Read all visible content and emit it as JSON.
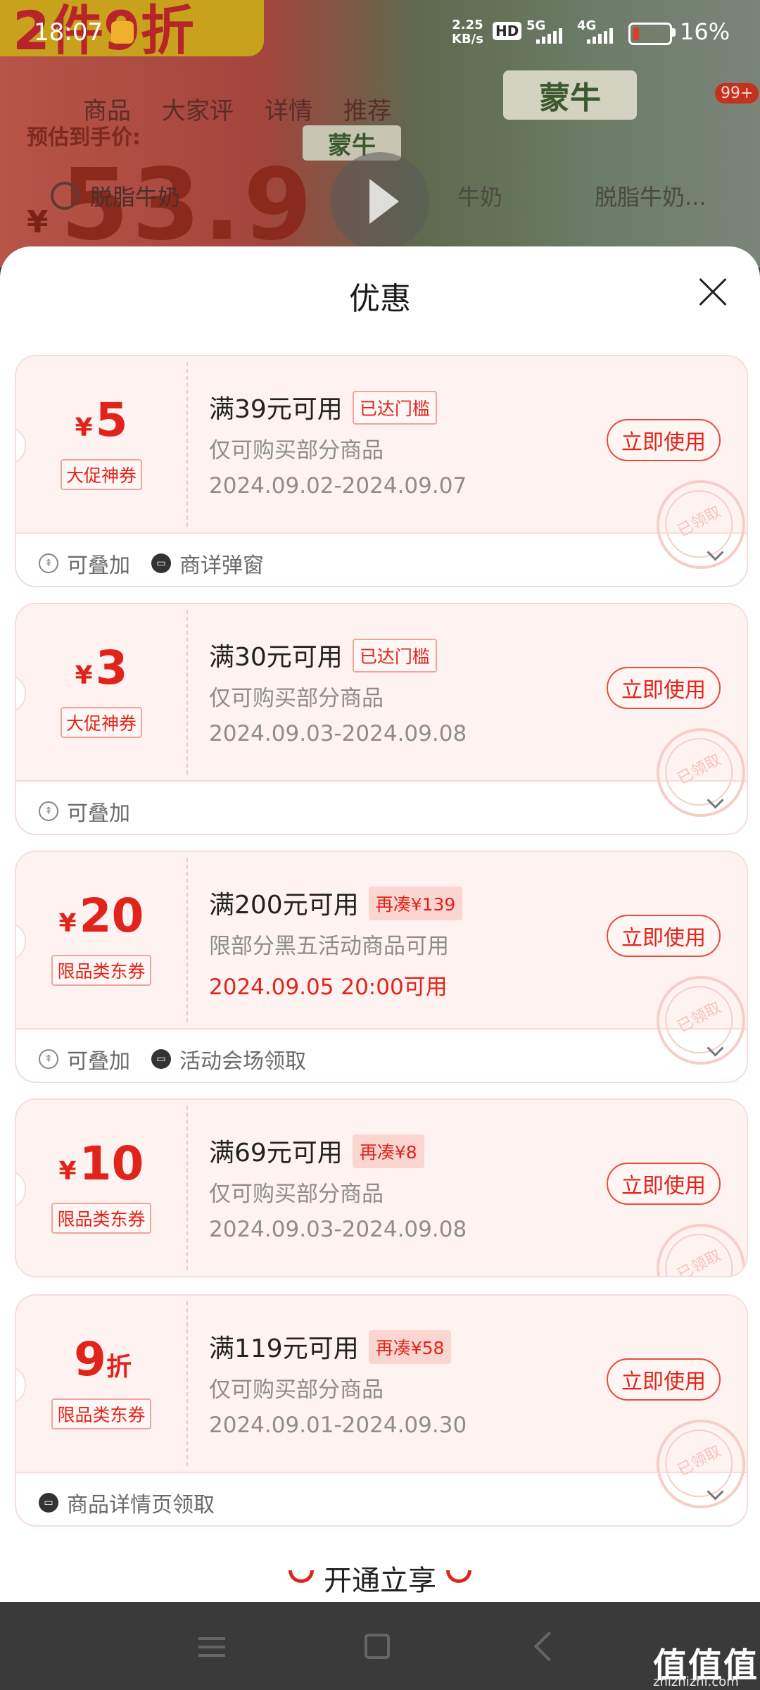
{
  "background": {
    "promo": "2件9折",
    "estimate_label": "预估到手价:",
    "price_symbol": "¥",
    "price": "53.9",
    "tabs": [
      "商品",
      "大家评",
      "详情",
      "推荐"
    ],
    "search_text": "脱脂牛奶",
    "search_text2": "牛奶",
    "search_text3": "脱脂牛奶...",
    "brand": "蒙牛",
    "brand_small": "蒙牛",
    "badge": "99+"
  },
  "status_bar": {
    "time": "18:07",
    "net_speed_top": "2.25",
    "net_speed_bottom": "KB/s",
    "hd": "HD",
    "sig1": "5G",
    "sig2": "4G",
    "battery": "16%"
  },
  "sheet": {
    "title": "优惠",
    "coupons": [
      {
        "currency": "¥",
        "amount": "5",
        "unit": "",
        "type": "大促神券",
        "condition": "满39元可用",
        "tag": "已达门槛",
        "scope": "仅可购买部分商品",
        "date": "2024.09.02-2024.09.07",
        "button": "立即使用",
        "stamp": "已领取"
      },
      {
        "currency": "¥",
        "amount": "3",
        "unit": "",
        "type": "大促神券",
        "condition": "满30元可用",
        "tag": "已达门槛",
        "scope": "仅可购买部分商品",
        "date": "2024.09.03-2024.09.08",
        "button": "立即使用",
        "stamp": "已领取"
      },
      {
        "currency": "¥",
        "amount": "20",
        "unit": "",
        "type": "限品类东券",
        "condition": "满200元可用",
        "tag": "再凑¥139",
        "scope": "限部分黑五活动商品可用",
        "date": "2024.09.05 20:00可用",
        "button": "立即使用",
        "stamp": "已领取"
      },
      {
        "currency": "¥",
        "amount": "10",
        "unit": "",
        "type": "限品类东券",
        "condition": "满69元可用",
        "tag": "再凑¥8",
        "scope": "仅可购买部分商品",
        "date": "2024.09.03-2024.09.08",
        "button": "立即使用",
        "stamp": "已领取"
      },
      {
        "currency": "",
        "amount": "9",
        "unit": "折",
        "type": "限品类东券",
        "condition": "满119元可用",
        "tag": "再凑¥58",
        "scope": "仅可购买部分商品",
        "date": "2024.09.01-2024.09.30",
        "button": "立即使用",
        "stamp": "已领取"
      }
    ],
    "footers": {
      "f1": {
        "stack": "可叠加",
        "window": "商详弹窗"
      },
      "f2": {
        "stack": "可叠加"
      },
      "f3": {
        "stack": "可叠加",
        "window": "活动会场领取"
      },
      "f5": {
        "window": "商品详情页领取"
      }
    },
    "open_label": "开通立享"
  },
  "watermark": {
    "title": "值值值",
    "url": "zhizhizhi.com"
  }
}
